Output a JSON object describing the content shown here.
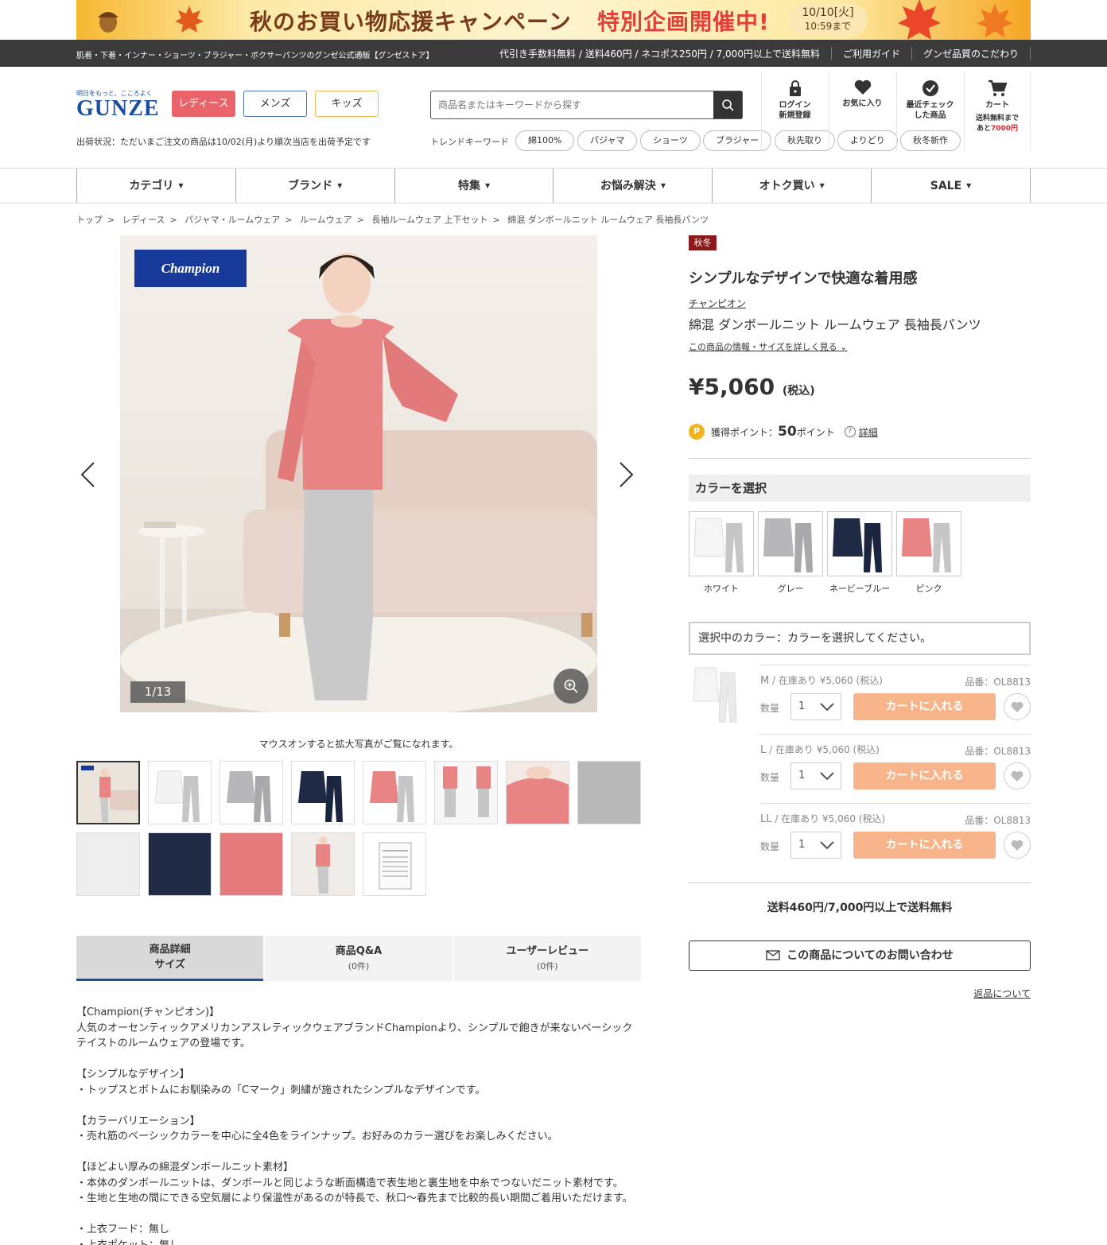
{
  "banner": {
    "title_a": "秋のお買い物応援キャンペーン",
    "title_b": "特別企画開催中!",
    "date_line1": "10/10[火]",
    "date_line2": "10:59まで"
  },
  "topbar": {
    "tagline": "肌着・下着・インナー・ショーツ・ブラジャー・ボクサーパンツのグンゼ公式通販【グンゼストア】",
    "shipping": "代引き手数料無料 / 送料460円 / ネコポス250円 / 7,000円以上で送料無料",
    "guide": "ご利用ガイド",
    "quality": "グンゼ品質のこだわり"
  },
  "header": {
    "logo_tagline": "明日をもっと、こころよく",
    "logo_name": "GUNZE",
    "gender_buttons": [
      "レディース",
      "メンズ",
      "キッズ"
    ],
    "ship_status": "出荷状況：ただいまご注文の商品は10/02(月)より順次当店を出荷予定です",
    "search_placeholder": "商品名またはキーワードから探す",
    "trend_label": "トレンドキーワード",
    "trends": [
      "綿100%",
      "パジャマ",
      "ショーツ",
      "ブラジャー",
      "秋先取り",
      "よりどり",
      "秋冬新作"
    ],
    "icons": {
      "login_l1": "ログイン",
      "login_l2": "新規登録",
      "fav": "お気に入り",
      "recent_l1": "最近チェック",
      "recent_l2": "した商品",
      "cart": "カート",
      "cart_note_l1": "送料無料まで",
      "cart_note_pre": "あと",
      "cart_note_amt": "7000円"
    }
  },
  "nav": [
    "カテゴリ",
    "ブランド",
    "特集",
    "お悩み解決",
    "オトク買い",
    "SALE"
  ],
  "breadcrumb": [
    "トップ",
    "レディース",
    "パジャマ・ルームウェア",
    "ルームウェア",
    "長袖ルームウェア 上下セット",
    "綿混 ダンボールニット ルームウェア 長袖長パンツ"
  ],
  "gallery": {
    "logo_text": "Champion",
    "counter": "1/13",
    "hint": "マウスオンすると拡大写真がご覧になれます。"
  },
  "tabs": {
    "t1_l1": "商品詳細",
    "t1_l2": "サイズ",
    "t2_l1": "商品Q&A",
    "t2_l2": "(0件)",
    "t3_l1": "ユーザーレビュー",
    "t3_l2": "(0件)"
  },
  "description": "【Champion(チャンピオン)】\n人気のオーセンティックアメリカンアスレティックウェアブランドChampionより、シンプルで飽きが来ないベーシックテイストのルームウェアの登場です。\n\n【シンプルなデザイン】\n・トップスとボトムにお馴染みの「Cマーク」刺繍が施されたシンプルなデザインです。\n\n【カラーバリエーション】\n・売れ筋のベーシックカラーを中心に全4色をラインナップ。お好みのカラー選びをお楽しみください。\n\n【ほどよい厚みの綿混ダンボールニット素材】\n・本体のダンボールニットは、ダンボールと同じような断面構造で表生地と裏生地を中糸でつないだニット素材です。\n・生地と生地の間にできる空気層により保温性があるのが特長で、秋口〜春先まで比較的長い期間ご着用いただけます。\n\n・上衣フード：無し\n・上衣ポケット：無し",
  "product": {
    "season": "秋冬",
    "catch": "シンプルなデザインで快適な着用感",
    "brand": "チャンピオン",
    "name": "綿混 ダンボールニット ルームウェア 長袖長パンツ",
    "detail_link": "この商品の情報・サイズを詳しく見る",
    "price": "¥5,060",
    "price_tax": "(税込)",
    "points_label": "獲得ポイント：",
    "points_value": "50",
    "points_unit": "ポイント",
    "points_detail": "詳細",
    "color_heading": "カラーを選択",
    "colors": [
      "ホワイト",
      "グレー",
      "ネービーブルー",
      "ピンク"
    ],
    "selected_color": "選択中のカラー：カラーを選択してください。",
    "sizes": [
      {
        "size": "M",
        "stock": " / 在庫あり ¥5,060 (税込)",
        "code": "品番：OL8813",
        "qty": "1"
      },
      {
        "size": "L",
        "stock": " / 在庫あり ¥5,060 (税込)",
        "code": "品番：OL8813",
        "qty": "1"
      },
      {
        "size": "LL",
        "stock": " / 在庫あり ¥5,060 (税込)",
        "code": "品番：OL8813",
        "qty": "1"
      }
    ],
    "qty_label": "数量",
    "cart_label": "カートに入れる",
    "ship_note": "送料460円/7,000円以上で送料無料",
    "inquiry": "この商品についてのお問い合わせ",
    "returns": "返品について"
  },
  "colors": {
    "accent_blue": "#1a4fa0",
    "ladies": "#e8646a",
    "cart_button": "#f7b48a",
    "season_badge": "#8b1a1a",
    "pink": "#e98484",
    "grey": "#c6c6c6",
    "navy": "#1f2a44"
  }
}
